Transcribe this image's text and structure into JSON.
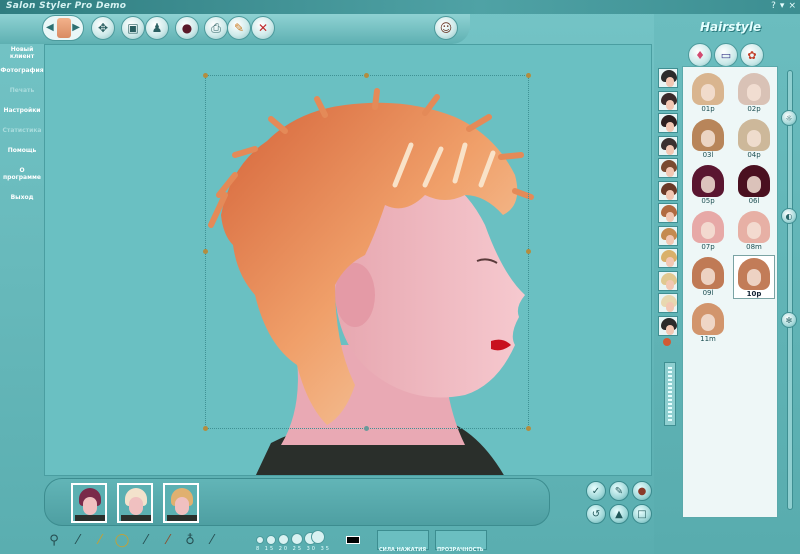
{
  "app": {
    "title": "Salon Styler Pro Demo",
    "win_controls": [
      "?",
      "▾",
      "×"
    ]
  },
  "left_menu": [
    {
      "label": "Новый клиент",
      "enabled": true
    },
    {
      "label": "Фотография",
      "enabled": true
    },
    {
      "label": "Печать",
      "enabled": false
    },
    {
      "label": "Настройки",
      "enabled": true
    },
    {
      "label": "Статистика",
      "enabled": false
    },
    {
      "label": "Помощь",
      "enabled": true
    },
    {
      "label": "О программе",
      "enabled": true
    },
    {
      "label": "Выход",
      "enabled": true
    }
  ],
  "right_panel": {
    "title": "Hairstyle",
    "gallery": [
      {
        "label": "01p",
        "color": "#d9b58f"
      },
      {
        "label": "02p",
        "color": "#d9c2b6"
      },
      {
        "label": "03l",
        "color": "#b8855a"
      },
      {
        "label": "04p",
        "color": "#cdb89a"
      },
      {
        "label": "05p",
        "color": "#5a1630"
      },
      {
        "label": "06l",
        "color": "#4a1020"
      },
      {
        "label": "07p",
        "color": "#e7a9a7"
      },
      {
        "label": "08m",
        "color": "#e7b0a5"
      },
      {
        "label": "09l",
        "color": "#c07a55"
      },
      {
        "label": "10p",
        "color": "#c27c58",
        "selected": true
      },
      {
        "label": "11m",
        "color": "#d2956c"
      }
    ],
    "side_thumb_colors": [
      "#2b2b2b",
      "#3a2a2a",
      "#2d2020",
      "#3a3030",
      "#7a4a30",
      "#6a3a28",
      "#b06a40",
      "#c48a50",
      "#d9b06a",
      "#e0c890",
      "#e8d8b0",
      "#2a2a2a"
    ]
  },
  "toolbar": {
    "tools": [
      "wand-icon",
      "pipette-icon",
      "pencil-icon",
      "ring-icon",
      "brush-icon",
      "dropper-icon",
      "lasso-icon",
      "smudge-icon"
    ],
    "brush_size_labels": "8 15 20 25 30 35",
    "color": "#000000",
    "slider1_label": "СИЛА НАЖАТИЯ",
    "slider2_label": "ПРОЗРАЧНОСТЬ"
  },
  "history": {
    "thumbs": [
      "#7a2a4a",
      "#e8d0b8",
      "#d8b070"
    ]
  }
}
